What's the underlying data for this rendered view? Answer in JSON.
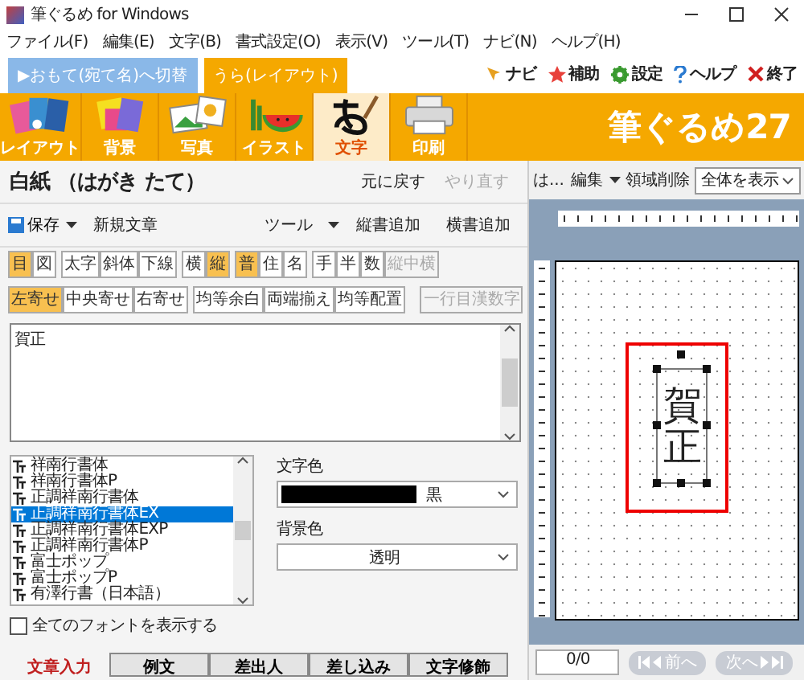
{
  "window": {
    "title": "筆ぐるめ for Windows"
  },
  "menu": [
    "ファイル(F)",
    "編集(E)",
    "文字(B)",
    "書式設定(O)",
    "表示(V)",
    "ツール(T)",
    "ナビ(N)",
    "ヘルプ(H)"
  ],
  "side_tabs": [
    {
      "label": "▶おもて(宛て名)へ切替",
      "selected": false
    },
    {
      "label": "うら(レイアウト)",
      "selected": true
    }
  ],
  "nav_links": [
    {
      "kind": "navi",
      "label": "ナビ"
    },
    {
      "kind": "assist",
      "label": "補助"
    },
    {
      "kind": "settings",
      "label": "設定"
    },
    {
      "kind": "help",
      "label": "ヘルプ"
    },
    {
      "kind": "exit",
      "label": "終了"
    }
  ],
  "toolbar": [
    {
      "kind": "layout",
      "label": "レイアウト",
      "selected": false
    },
    {
      "kind": "background",
      "label": "背景",
      "selected": false
    },
    {
      "kind": "photo",
      "label": "写真",
      "selected": false
    },
    {
      "kind": "illust",
      "label": "イラスト",
      "selected": false
    },
    {
      "kind": "text",
      "label": "文字",
      "selected": true
    },
    {
      "kind": "print",
      "label": "印刷",
      "selected": false
    }
  ],
  "logo": "筆ぐるめ27",
  "document": {
    "title": "白紙 （はがき たて）",
    "undo": {
      "label": "元に戻す",
      "disabled": false
    },
    "redo": {
      "label": "やり直す",
      "disabled": true
    }
  },
  "file_bar": {
    "save": "保存",
    "new_text": "新規文章",
    "tools": "ツール",
    "add_vertical": "縦書追加",
    "add_horizontal": "横書追加"
  },
  "format_rows": [
    [
      [
        {
          "label": "目",
          "selected": true,
          "disabled": false
        },
        {
          "label": "図",
          "selected": false,
          "disabled": false
        }
      ],
      [
        {
          "label": "太字",
          "selected": false,
          "disabled": false
        },
        {
          "label": "斜体",
          "selected": false,
          "disabled": false
        },
        {
          "label": "下線",
          "selected": false,
          "disabled": false
        }
      ],
      [
        {
          "label": "横",
          "selected": false,
          "disabled": false
        },
        {
          "label": "縦",
          "selected": true,
          "disabled": false
        }
      ],
      [
        {
          "label": "普",
          "selected": true,
          "disabled": false
        },
        {
          "label": "住",
          "selected": false,
          "disabled": false
        },
        {
          "label": "名",
          "selected": false,
          "disabled": false
        }
      ],
      [
        {
          "label": "手",
          "selected": false,
          "disabled": false
        },
        {
          "label": "半",
          "selected": false,
          "disabled": false
        },
        {
          "label": "数",
          "selected": false,
          "disabled": false
        },
        {
          "label": "縦中横",
          "selected": false,
          "disabled": true
        }
      ]
    ],
    [
      [
        {
          "label": "左寄せ",
          "selected": true,
          "disabled": false
        },
        {
          "label": "中央寄せ",
          "selected": false,
          "disabled": false
        },
        {
          "label": "右寄せ",
          "selected": false,
          "disabled": false
        }
      ],
      [
        {
          "label": "均等余白",
          "selected": false,
          "disabled": false
        },
        {
          "label": "両端揃え",
          "selected": false,
          "disabled": false
        },
        {
          "label": "均等配置",
          "selected": false,
          "disabled": false
        }
      ],
      [
        {
          "label": "一行目漢数字",
          "selected": false,
          "disabled": true
        }
      ]
    ]
  ],
  "text_input": "賀正",
  "font_list": [
    {
      "label": "祥南行書体",
      "selected": false
    },
    {
      "label": "祥南行書体P",
      "selected": false
    },
    {
      "label": "正調祥南行書体",
      "selected": false
    },
    {
      "label": "正調祥南行書体EX",
      "selected": true
    },
    {
      "label": "正調祥南行書体EXP",
      "selected": false
    },
    {
      "label": "正調祥南行書体P",
      "selected": false
    },
    {
      "label": "富士ポップ",
      "selected": false
    },
    {
      "label": "富士ポップP",
      "selected": false
    },
    {
      "label": "有澤行書（日本語）",
      "selected": false
    }
  ],
  "text_color": {
    "label": "文字色",
    "value": "黒"
  },
  "background_color": {
    "label": "背景色",
    "value": "透明"
  },
  "show_all_fonts": {
    "label": "全てのフォントを表示する",
    "checked": false
  },
  "bottom_tabs": [
    {
      "label": "文章入力",
      "selected": true
    },
    {
      "label": "例文",
      "selected": false
    },
    {
      "label": "差出人",
      "selected": false
    },
    {
      "label": "差し込み",
      "selected": false
    },
    {
      "label": "文字修飾",
      "selected": false
    }
  ],
  "preview_toolbar": {
    "truncated": "は...",
    "edit": "編集",
    "delete_area": "領域削除",
    "zoom": "全体を表示"
  },
  "card_text": "賀正",
  "pager": {
    "page": "0/0",
    "prev": "前へ",
    "next": "次へ",
    "disabled": true
  }
}
